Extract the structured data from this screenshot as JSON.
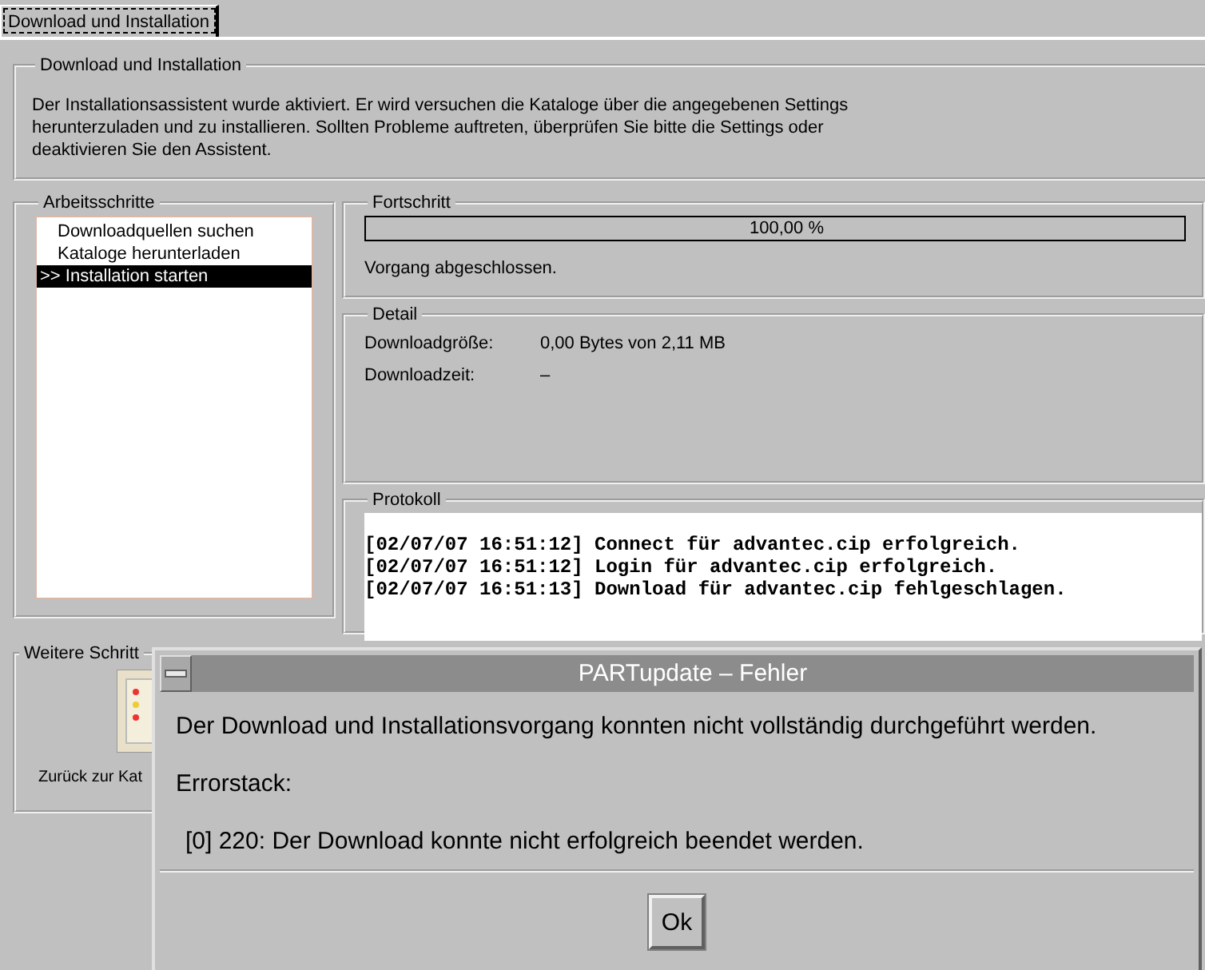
{
  "tabs": [
    {
      "label": "Download und Installation",
      "selected": true
    }
  ],
  "info": {
    "title": "Download und Installation",
    "text": "Der Installationsassistent wurde aktiviert. Er wird versuchen die Kataloge über die angegebenen Settings herunterzuladen und zu installieren. Sollten Probleme auftreten, überprüfen Sie bitte die Settings oder deaktivieren Sie den Assistent."
  },
  "steps": {
    "title": "Arbeitsschritte",
    "items": [
      {
        "label": "Downloadquellen suchen",
        "selected": false
      },
      {
        "label": "Kataloge herunterladen",
        "selected": false
      },
      {
        "label": ">> Installation starten",
        "selected": true
      }
    ]
  },
  "progress": {
    "title": "Fortschritt",
    "level": 1,
    "reading": "100,00 %",
    "status": "Vorgang abgeschlossen."
  },
  "detail": {
    "title": "Detail",
    "rows": [
      {
        "label": "Downloadgröße:",
        "value": "0,00 Bytes von 2,11 MB"
      },
      {
        "label": "Downloadzeit:",
        "value": "–"
      }
    ]
  },
  "log": {
    "title": "Protokoll",
    "lines": [
      "[02/07/07 16:51:12] Connect für advantec.cip erfolgreich.",
      "[02/07/07 16:51:12] Login für advantec.cip erfolgreich.",
      "[02/07/07 16:51:13] Download für advantec.cip fehlgeschlagen."
    ]
  },
  "more": {
    "title": "Weitere Schritt",
    "action": "Zurück zur Kat"
  },
  "dialog": {
    "title": "PARTupdate – Fehler",
    "message": "Der Download und Installationsvorgang konnten nicht vollständig durchgeführt werden.",
    "stack_title": "Errorstack:",
    "stack": [
      "[0] 220: Der Download konnte nicht erfolgreich beendet werden."
    ],
    "buttons": [
      "Ok"
    ]
  }
}
